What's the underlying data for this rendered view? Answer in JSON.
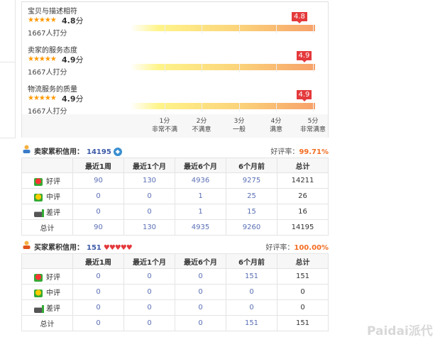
{
  "ratings": [
    {
      "title": "宝贝与描述相符",
      "stars": "★★★★★",
      "score": "4.8",
      "unit": "分",
      "count": "1667人打分",
      "flag": "4.8",
      "value": 4.8
    },
    {
      "title": "卖家的服务态度",
      "stars": "★★★★★",
      "score": "4.9",
      "unit": "分",
      "count": "1667人打分",
      "flag": "4.9",
      "value": 4.9
    },
    {
      "title": "物流服务的质量",
      "stars": "★★★★★",
      "score": "4.9",
      "unit": "分",
      "count": "1667人打分",
      "flag": "4.9",
      "value": 4.9
    }
  ],
  "axis": [
    {
      "score": "1分",
      "label": "非常不满"
    },
    {
      "score": "2分",
      "label": "不满意"
    },
    {
      "score": "3分",
      "label": "一般"
    },
    {
      "score": "4分",
      "label": "满意"
    },
    {
      "score": "5分",
      "label": "非常满意"
    }
  ],
  "seller": {
    "label": "卖家累积信用：",
    "value": "14195",
    "rate_label": "好评率：",
    "rate": "99.71%"
  },
  "buyer": {
    "label": "买家累积信用：",
    "value": "151",
    "hearts": "♥♥♥♥♥",
    "rate_label": "好评率：",
    "rate": "100.00%"
  },
  "columns": [
    "",
    "最近1周",
    "最近1个月",
    "最近6个月",
    "6个月前",
    "总计"
  ],
  "seller_rows": [
    {
      "label": "好评",
      "cells": [
        "90",
        "130",
        "4936",
        "9275",
        "14211"
      ]
    },
    {
      "label": "中评",
      "cells": [
        "0",
        "0",
        "1",
        "25",
        "26"
      ]
    },
    {
      "label": "差评",
      "cells": [
        "0",
        "0",
        "1",
        "15",
        "16"
      ]
    },
    {
      "label": "总计",
      "cells": [
        "90",
        "130",
        "4935",
        "9260",
        "14195"
      ]
    }
  ],
  "buyer_rows": [
    {
      "label": "好评",
      "cells": [
        "0",
        "0",
        "0",
        "151",
        "151"
      ]
    },
    {
      "label": "中评",
      "cells": [
        "0",
        "0",
        "0",
        "0",
        "0"
      ]
    },
    {
      "label": "差评",
      "cells": [
        "0",
        "0",
        "0",
        "0",
        "0"
      ]
    },
    {
      "label": "总计",
      "cells": [
        "0",
        "0",
        "0",
        "151",
        "151"
      ]
    }
  ],
  "watermark": "Paidai派代"
}
